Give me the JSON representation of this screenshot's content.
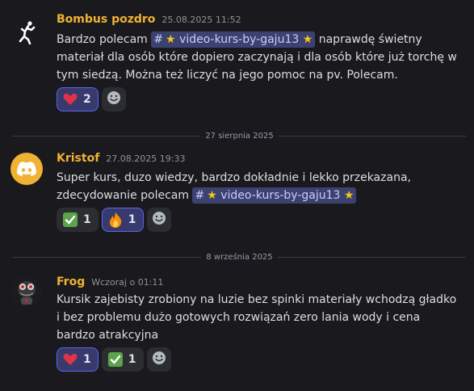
{
  "messages": [
    {
      "author": "Bombus pozdro",
      "timestamp": "25.08.2025 11:52",
      "text_before": "Bardzo polecam",
      "channel": "video-kurs-by-gaju13",
      "text_after": "naprawdę świetny materiał dla osób które dopiero zaczynają i dla osób które już torchę w tym siedzą. Można też liczyć na jego pomoc na pv. Polecam.",
      "reactions": [
        {
          "emoji": "heart",
          "count": "2",
          "selected": true
        }
      ]
    },
    {
      "author": "Kristof",
      "timestamp": "27.08.2025 19:33",
      "text_before": "Super kurs, duzo wiedzy, bardzo dokładnie i lekko przekazana, zdecydowanie polecam",
      "channel": "video-kurs-by-gaju13",
      "reactions": [
        {
          "emoji": "check",
          "count": "1",
          "selected": false
        },
        {
          "emoji": "fire",
          "count": "1",
          "selected": true
        }
      ]
    },
    {
      "author": "Frog",
      "timestamp": "Wczoraj o 01:11",
      "text": "Kursik zajebisty zrobiony na luzie bez spinki materiały wchodzą gładko i bez problemu dużo gotowych rozwiązań zero lania wody i cena bardzo atrakcyjna",
      "reactions": [
        {
          "emoji": "heart",
          "count": "1",
          "selected": true
        },
        {
          "emoji": "check",
          "count": "1",
          "selected": false
        }
      ]
    }
  ],
  "dividers": [
    "27 sierpnia 2025",
    "8 września 2025"
  ],
  "icons": {
    "avatar_1": "dancing-figure-icon",
    "avatar_2": "discord-logo-icon",
    "avatar_3": "frog-skull-icon",
    "add_reaction": "smiley-add-reaction-icon"
  },
  "colors": {
    "background": "#1a1a1e",
    "author": "#f0b232",
    "mention_bg": "#3c4270",
    "discord_avatar": "#f0b232"
  }
}
